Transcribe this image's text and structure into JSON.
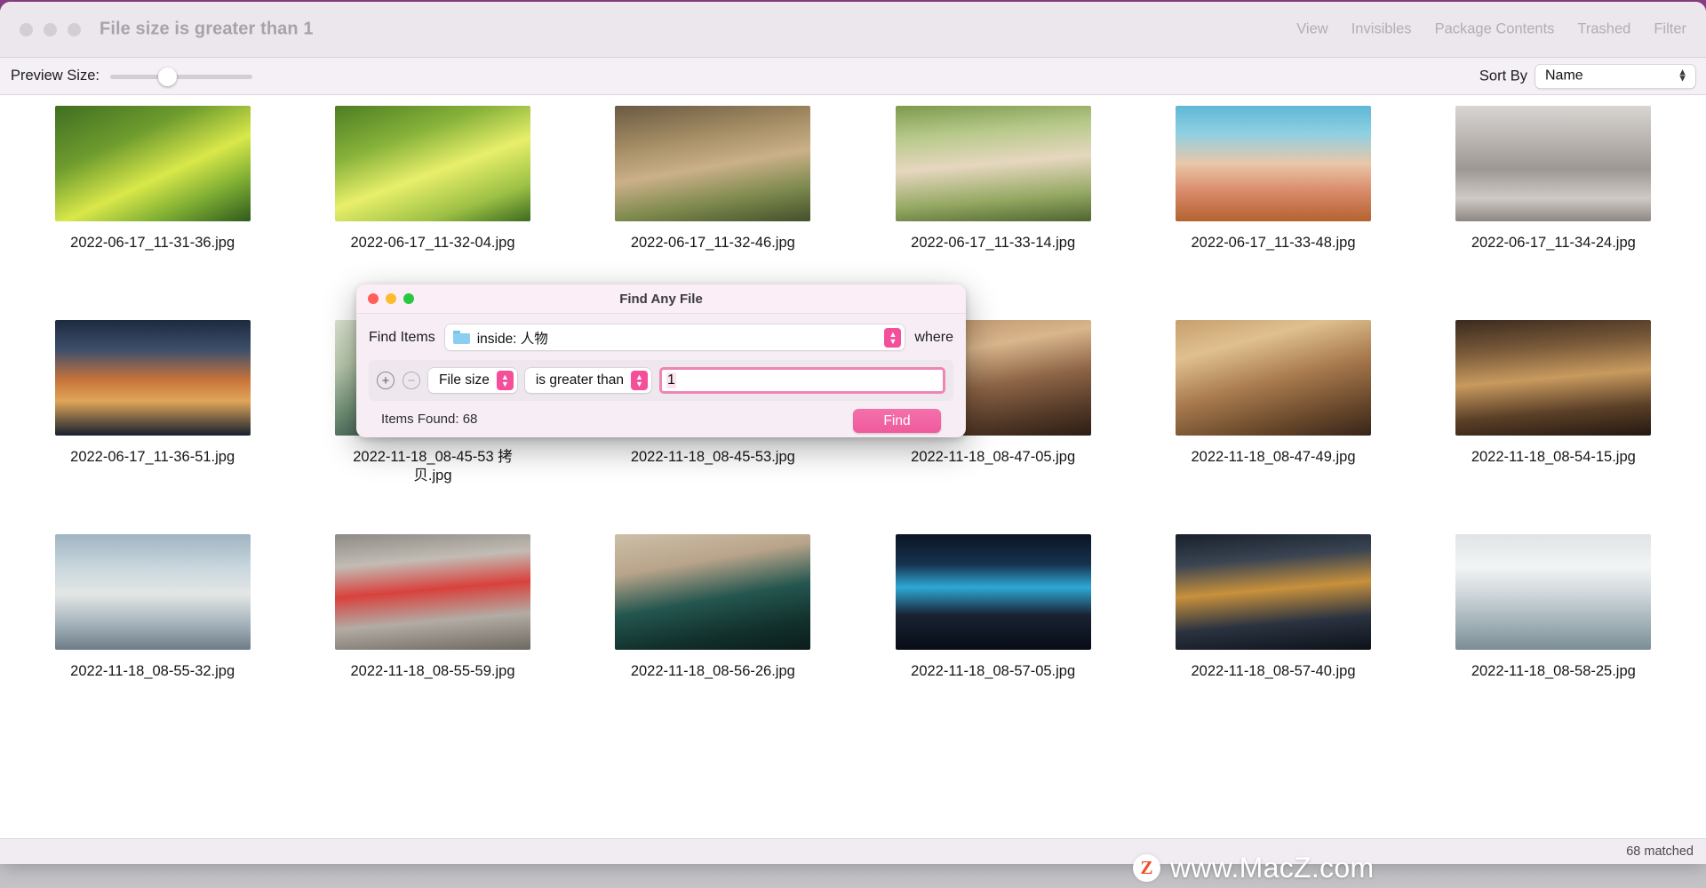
{
  "window": {
    "title": "File size is greater than 1",
    "menu": [
      "View",
      "Invisibles",
      "Package Contents",
      "Trashed",
      "Filter"
    ],
    "traffic_lights": [
      "close-icon",
      "minimize-icon",
      "zoom-icon"
    ]
  },
  "toolbar": {
    "preview_size_label": "Preview Size:",
    "sort_by_label": "Sort By",
    "sort_by_value": "Name",
    "preview_size_percent": 40
  },
  "files": [
    {
      "name": "2022-06-17_11-31-36.jpg"
    },
    {
      "name": "2022-06-17_11-32-04.jpg"
    },
    {
      "name": "2022-06-17_11-32-46.jpg"
    },
    {
      "name": "2022-06-17_11-33-14.jpg"
    },
    {
      "name": "2022-06-17_11-33-48.jpg"
    },
    {
      "name": "2022-06-17_11-34-24.jpg"
    },
    {
      "name": "2022-06-17_11-36-51.jpg"
    },
    {
      "name": "2022-11-18_08-45-53 拷贝.jpg"
    },
    {
      "name": "2022-11-18_08-45-53.jpg"
    },
    {
      "name": "2022-11-18_08-47-05.jpg"
    },
    {
      "name": "2022-11-18_08-47-49.jpg"
    },
    {
      "name": "2022-11-18_08-54-15.jpg"
    },
    {
      "name": "2022-11-18_08-55-32.jpg"
    },
    {
      "name": "2022-11-18_08-55-59.jpg"
    },
    {
      "name": "2022-11-18_08-56-26.jpg"
    },
    {
      "name": "2022-11-18_08-57-05.jpg"
    },
    {
      "name": "2022-11-18_08-57-40.jpg"
    },
    {
      "name": "2022-11-18_08-58-25.jpg"
    }
  ],
  "statusbar": {
    "text": "68 matched"
  },
  "watermark": {
    "logo": "Z",
    "text": "www.MacZ.com"
  },
  "dialog": {
    "title": "Find Any File",
    "find_items_label": "Find Items",
    "scope_value": "inside: 人物",
    "scope_icon": "folder-icon",
    "where_label": "where",
    "add_button": "+",
    "remove_button": "−",
    "attribute_value": "File size",
    "comparator_value": "is greater than",
    "criteria_value": "1",
    "items_found": "Items Found: 68",
    "find_button": "Find",
    "accent_color": "#f54f9a"
  }
}
